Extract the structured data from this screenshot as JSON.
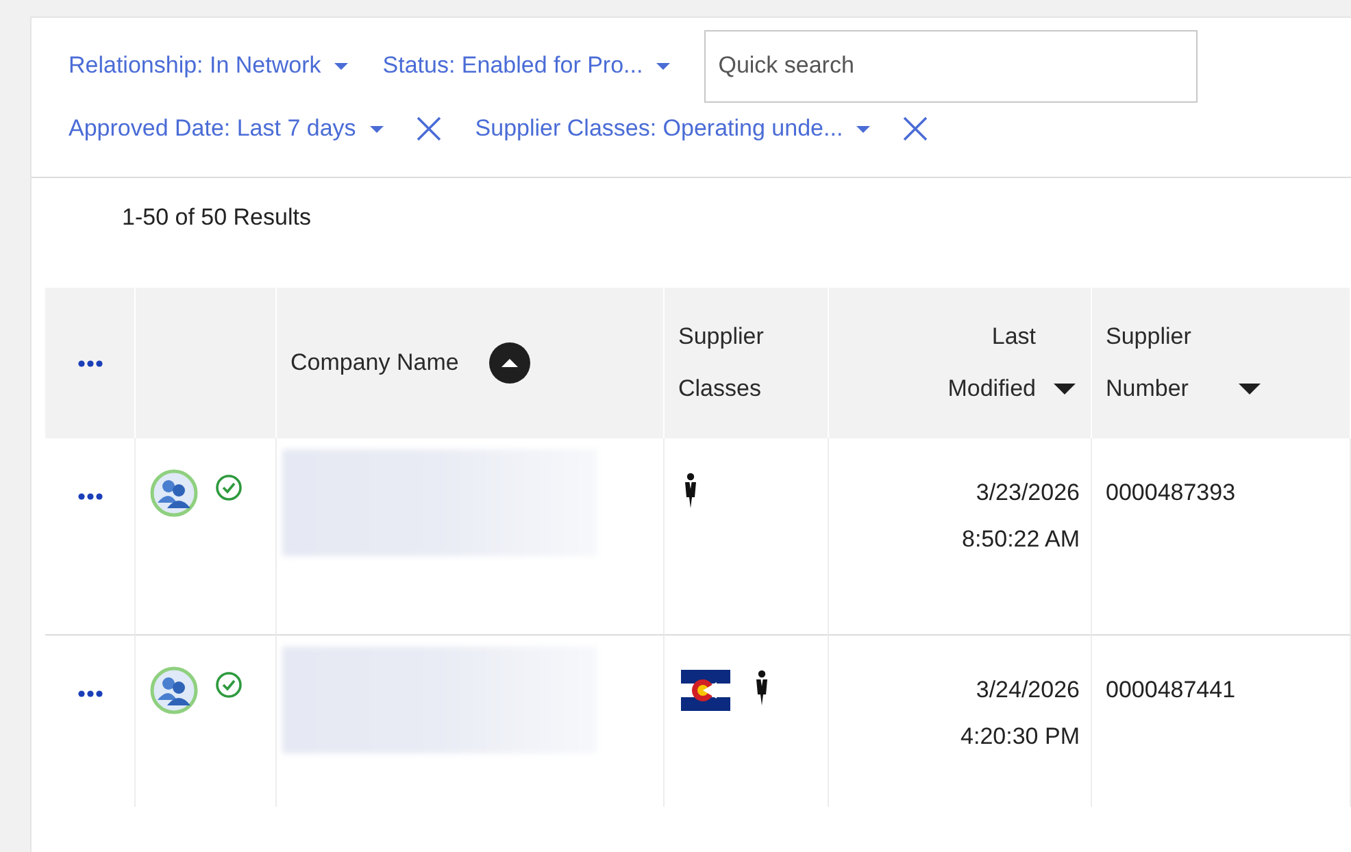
{
  "filters": [
    {
      "label": "Relationship: In Network",
      "removable": false
    },
    {
      "label": "Status: Enabled for Pro...",
      "removable": false
    },
    {
      "label": "Approved Date: Last 7 days",
      "removable": true
    },
    {
      "label": "Supplier Classes: Operating unde...",
      "removable": true
    }
  ],
  "search": {
    "placeholder": "Quick search"
  },
  "results": "1-50 of 50 Results",
  "table": {
    "columns": [
      {
        "label": "Company Name",
        "ascending": true
      },
      {
        "label": "Supplier Classes"
      },
      {
        "label": "Last Modified",
        "ascending": false
      },
      {
        "label": "Supplier Number",
        "ascending": false
      }
    ],
    "rows": [
      {
        "classes": [
          {
            "kind": "person"
          }
        ],
        "date": "3/23/2026",
        "time": "8:50:22 AM",
        "number": "0000487393"
      },
      {
        "classes": [
          {
            "kind": "flag"
          },
          {
            "kind": "person"
          }
        ],
        "date": "3/24/2026",
        "time": "4:20:30 PM",
        "number": "0000487441"
      }
    ]
  }
}
